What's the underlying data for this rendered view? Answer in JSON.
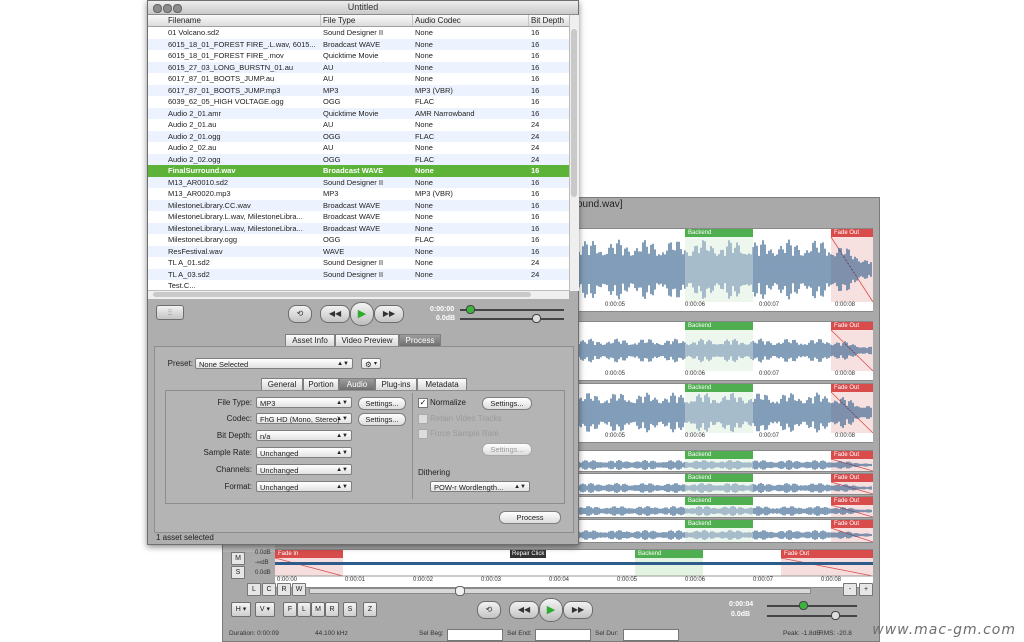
{
  "browser": {
    "title": "Untitled",
    "columns": [
      "Filename",
      "File Type",
      "Audio Codec",
      "Bit Depth"
    ],
    "rows": [
      [
        "01 Volcano.sd2",
        "Sound Designer II",
        "None",
        "16"
      ],
      [
        "6015_18_01_FOREST FIRE_.L.wav, 6015...",
        "Broadcast WAVE",
        "None",
        "16"
      ],
      [
        "6015_18_01_FOREST FIRE_.mov",
        "Quicktime Movie",
        "None",
        "16"
      ],
      [
        "6015_27_03_LONG_BURSTN_01.au",
        "AU",
        "None",
        "16"
      ],
      [
        "6017_87_01_BOOTS_JUMP.au",
        "AU",
        "None",
        "16"
      ],
      [
        "6017_87_01_BOOTS_JUMP.mp3",
        "MP3",
        "MP3 (VBR)",
        "16"
      ],
      [
        "6039_62_05_HIGH VOLTAGE.ogg",
        "OGG",
        "FLAC",
        "16"
      ],
      [
        "Audio 2_01.amr",
        "Quicktime Movie",
        "AMR Narrowband",
        "16"
      ],
      [
        "Audio 2_01.au",
        "AU",
        "None",
        "24"
      ],
      [
        "Audio 2_01.ogg",
        "OGG",
        "FLAC",
        "24"
      ],
      [
        "Audio 2_02.au",
        "AU",
        "None",
        "24"
      ],
      [
        "Audio 2_02.ogg",
        "OGG",
        "FLAC",
        "24"
      ],
      [
        "FinalSurround.wav",
        "Broadcast WAVE",
        "None",
        "16"
      ],
      [
        "M13_AR0010.sd2",
        "Sound Designer II",
        "None",
        "16"
      ],
      [
        "M13_AR0020.mp3",
        "MP3",
        "MP3 (VBR)",
        "16"
      ],
      [
        "MilestoneLibrary.CC.wav",
        "Broadcast WAVE",
        "None",
        "16"
      ],
      [
        "MilestoneLibrary.L.wav, MilestoneLibra...",
        "Broadcast WAVE",
        "None",
        "16"
      ],
      [
        "MilestoneLibrary.L.wav, MilestoneLibra...",
        "Broadcast WAVE",
        "None",
        "16"
      ],
      [
        "MilestoneLibrary.ogg",
        "OGG",
        "FLAC",
        "16"
      ],
      [
        "ResFestival.wav",
        "WAVE",
        "None",
        "16"
      ],
      [
        "TL A_01.sd2",
        "Sound Designer II",
        "None",
        "24"
      ],
      [
        "TL A_03.sd2",
        "Sound Designer II",
        "None",
        "24"
      ],
      [
        "Test.C...",
        "",
        "",
        ""
      ]
    ],
    "selected_row": 12,
    "transport": {
      "time": "0:00:00",
      "level": "0.0dB"
    },
    "tabs": [
      "Asset Info",
      "Video Preview",
      "Process"
    ],
    "active_tab": 2,
    "process": {
      "preset_label": "Preset:",
      "preset_value": "None Selected",
      "subtabs": [
        "General",
        "Portion",
        "Audio",
        "Plug-ins",
        "Metadata"
      ],
      "active_subtab": 2,
      "file_type_label": "File Type:",
      "file_type": "MP3",
      "codec_label": "Codec:",
      "codec": "FhG HD (Mono, Stereo)",
      "bit_depth_label": "Bit Depth:",
      "bit_depth": "n/a",
      "sample_rate_label": "Sample Rate:",
      "sample_rate": "Unchanged",
      "channels_label": "Channels:",
      "channels": "Unchanged",
      "format_label": "Format:",
      "format": "Unchanged",
      "settings_label": "Settings...",
      "normalize_label": "Normalize",
      "retain_video_label": "Retain Video Tracks",
      "force_sample_rate_label": "Force Sample Rate",
      "dithering_label": "Dithering",
      "dithering_value": "POW-r Wordlength...",
      "process_button": "Process"
    },
    "status": "1 asset selected"
  },
  "editor": {
    "title_fragment": "ound.wav]",
    "region_labels": {
      "backend": "Backend",
      "fade_out": "Fade Out",
      "fade_in": "Fade In",
      "repair": "Repair Click"
    },
    "track_times": [
      "0:00:05",
      "0:00:06",
      "0:00:07",
      "0:00:08"
    ],
    "bottom_times": [
      "0:00:00",
      "0:00:01",
      "0:00:02",
      "0:00:03",
      "0:00:04",
      "0:00:05",
      "0:00:06",
      "0:00:07",
      "0:00:08"
    ],
    "levels": [
      "0.0dB",
      "-∞dB",
      "0.0dB"
    ],
    "side_buttons": [
      "M",
      "S"
    ],
    "lcr": [
      "L",
      "C",
      "R",
      "W"
    ],
    "zoom": [
      "-",
      "+"
    ],
    "view_buttons": [
      "H",
      "V",
      "F",
      "L",
      "M",
      "R",
      "S",
      "Z"
    ],
    "transport": {
      "time": "0:00:04",
      "level": "0.0dB"
    },
    "status": {
      "duration": "Duration: 0:00:09",
      "sample_rate": "44.100 kHz",
      "sel_beg": "Sel Beg:",
      "sel_end": "Sel End:",
      "sel_dur": "Sel Dur:",
      "peak": "Peak: -1.8dB",
      "rms": "RMS: -20.8"
    }
  },
  "watermark": "www.mac-gm.com",
  "colors": {
    "selection": "#5cb338",
    "backend_region": "#4fae4f",
    "fade_region": "#d94c4c",
    "waveform": "#2e5c8a"
  }
}
